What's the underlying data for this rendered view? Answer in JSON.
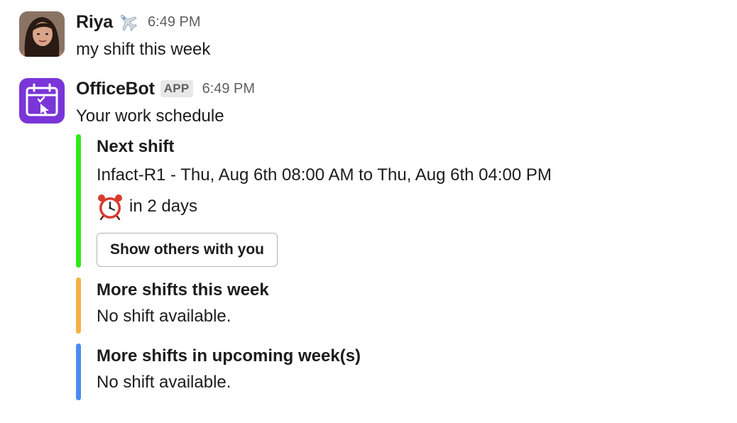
{
  "messages": [
    {
      "sender": "Riya",
      "status_emoji": "airplane-icon",
      "time": "6:49 PM",
      "text": "my shift this week"
    },
    {
      "sender": "OfficeBot",
      "badge": "APP",
      "time": "6:49 PM",
      "text": "Your work schedule",
      "attachments": [
        {
          "color": "#2eea1a",
          "title": "Next shift",
          "detail": "Infact-R1 - Thu, Aug 6th 08:00 AM to Thu, Aug 6th 04:00 PM",
          "countdown_icon": "alarm-clock-icon",
          "countdown": "in 2 days",
          "button_label": "Show others with you"
        },
        {
          "color": "#f5b041",
          "title": "More shifts this week",
          "detail": "No shift available."
        },
        {
          "color": "#4a8cf0",
          "title": "More shifts in upcoming week(s)",
          "detail": "No shift available."
        }
      ]
    }
  ]
}
